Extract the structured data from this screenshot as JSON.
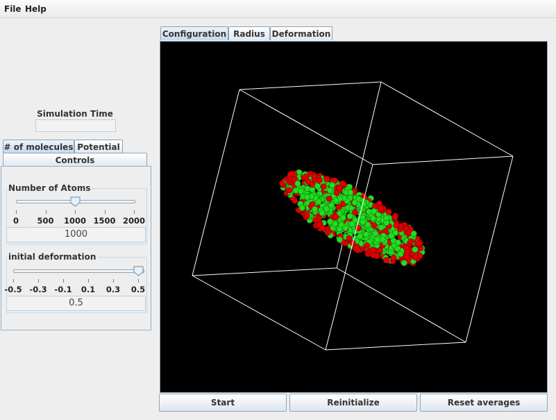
{
  "menu": {
    "file": "File",
    "help": "Help"
  },
  "sim_time": {
    "label": "Simulation Time (ps)",
    "value": ""
  },
  "left_tabs": {
    "molecules": "# of molecules",
    "potential": "Potential",
    "controls": "Controls"
  },
  "atoms": {
    "title": "Number of Atoms",
    "ticks": [
      "0",
      "500",
      "1000",
      "1500",
      "2000"
    ],
    "value": "1000",
    "min": 0,
    "max": 2000
  },
  "deform": {
    "title": "initial deformation",
    "ticks": [
      "-0.5",
      "-0.3",
      "-0.1",
      "0.1",
      "0.3",
      "0.5"
    ],
    "value": "0.5",
    "min": -0.5,
    "max": 0.5
  },
  "main_tabs": {
    "configuration": "Configuration",
    "radius": "Radius",
    "deformation": "Deformation"
  },
  "buttons": {
    "start": "Start",
    "reinitialize": "Reinitialize",
    "reset": "Reset averages"
  },
  "colors": {
    "atom_red": "#e00000",
    "atom_green": "#22dd22",
    "box_edges": "#ffffff",
    "canvas_bg": "#000000"
  }
}
